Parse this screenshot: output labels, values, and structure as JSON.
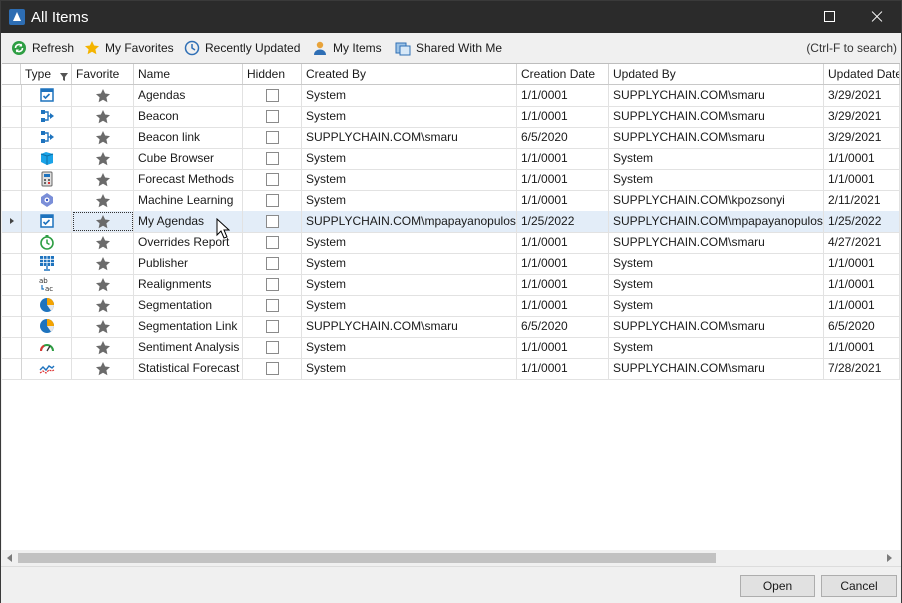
{
  "window": {
    "title": "All Items"
  },
  "toolbar": {
    "refresh": "Refresh",
    "favorites": "My Favorites",
    "recent": "Recently Updated",
    "my_items": "My Items",
    "shared": "Shared With Me",
    "search_hint": "(Ctrl-F to search)"
  },
  "columns": [
    "Type",
    "Favorite",
    "Name",
    "Hidden",
    "Created By",
    "Creation Date",
    "Updated By",
    "Updated Date"
  ],
  "rows": [
    {
      "type_icon": "agenda-icon",
      "name": "Agendas",
      "created_by": "System",
      "creation_date": "1/1/0001",
      "updated_by": "SUPPLYCHAIN.COM\\smaru",
      "updated_date": "3/29/2021"
    },
    {
      "type_icon": "beacon-icon",
      "name": "Beacon",
      "created_by": "System",
      "creation_date": "1/1/0001",
      "updated_by": "SUPPLYCHAIN.COM\\smaru",
      "updated_date": "3/29/2021"
    },
    {
      "type_icon": "beacon-icon",
      "name": "Beacon link",
      "created_by": "SUPPLYCHAIN.COM\\smaru",
      "creation_date": "6/5/2020",
      "updated_by": "SUPPLYCHAIN.COM\\smaru",
      "updated_date": "3/29/2021"
    },
    {
      "type_icon": "cube-icon",
      "name": "Cube Browser",
      "created_by": "System",
      "creation_date": "1/1/0001",
      "updated_by": "System",
      "updated_date": "1/1/0001"
    },
    {
      "type_icon": "calculator-icon",
      "name": "Forecast Methods",
      "created_by": "System",
      "creation_date": "1/1/0001",
      "updated_by": "System",
      "updated_date": "1/1/0001"
    },
    {
      "type_icon": "network-icon",
      "name": "Machine Learning",
      "created_by": "System",
      "creation_date": "1/1/0001",
      "updated_by": "SUPPLYCHAIN.COM\\kpozsonyi",
      "updated_date": "2/11/2021"
    },
    {
      "type_icon": "agenda-icon",
      "name": "My Agendas",
      "created_by": "SUPPLYCHAIN.COM\\mpapayanopulos",
      "creation_date": "1/25/2022",
      "updated_by": "SUPPLYCHAIN.COM\\mpapayanopulos",
      "updated_date": "1/25/2022",
      "selected": true
    },
    {
      "type_icon": "clock-icon",
      "name": "Overrides Report",
      "created_by": "System",
      "creation_date": "1/1/0001",
      "updated_by": "SUPPLYCHAIN.COM\\smaru",
      "updated_date": "4/27/2021"
    },
    {
      "type_icon": "grid-icon",
      "name": "Publisher",
      "created_by": "System",
      "creation_date": "1/1/0001",
      "updated_by": "System",
      "updated_date": "1/1/0001"
    },
    {
      "type_icon": "realign-icon",
      "name": "Realignments",
      "created_by": "System",
      "creation_date": "1/1/0001",
      "updated_by": "System",
      "updated_date": "1/1/0001"
    },
    {
      "type_icon": "pie-icon",
      "name": "Segmentation",
      "created_by": "System",
      "creation_date": "1/1/0001",
      "updated_by": "System",
      "updated_date": "1/1/0001"
    },
    {
      "type_icon": "pie-icon",
      "name": "Segmentation Link",
      "created_by": "SUPPLYCHAIN.COM\\smaru",
      "creation_date": "6/5/2020",
      "updated_by": "SUPPLYCHAIN.COM\\smaru",
      "updated_date": "6/5/2020"
    },
    {
      "type_icon": "gauge-icon",
      "name": "Sentiment Analysis",
      "created_by": "System",
      "creation_date": "1/1/0001",
      "updated_by": "System",
      "updated_date": "1/1/0001"
    },
    {
      "type_icon": "trend-icon",
      "name": "Statistical Forecast",
      "created_by": "System",
      "creation_date": "1/1/0001",
      "updated_by": "SUPPLYCHAIN.COM\\smaru",
      "updated_date": "7/28/2021"
    }
  ],
  "footer": {
    "open": "Open",
    "cancel": "Cancel"
  },
  "colors": {
    "titlebar": "#2b2b2b",
    "selection": "#e3edf8",
    "icon_blue": "#1e73be",
    "star": "#6b6b6b"
  }
}
